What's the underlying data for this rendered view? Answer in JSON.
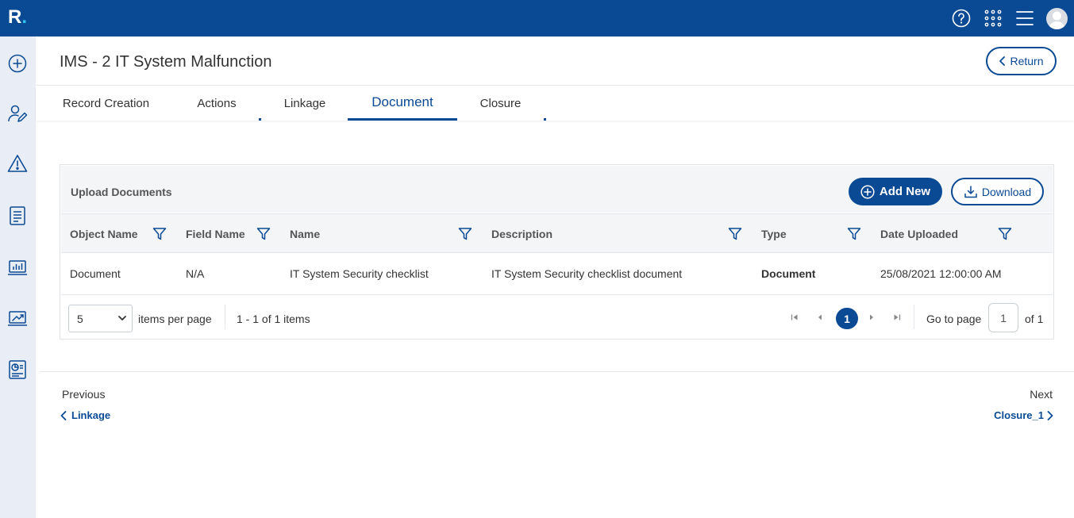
{
  "app": {
    "logo_letter": "R",
    "logo_dot": "."
  },
  "topbar": {
    "icons": [
      "help-icon",
      "apps-grid-icon",
      "menu-icon",
      "user-avatar"
    ]
  },
  "sidebar": {
    "icons": [
      "add-circle-icon",
      "user-edit-icon",
      "warning-icon",
      "document-list-icon",
      "laptop-chart-icon",
      "trend-chart-icon",
      "report-icon"
    ]
  },
  "header": {
    "title": "IMS - 2 IT System Malfunction",
    "return_label": "Return"
  },
  "tabs": [
    {
      "label": "Record Creation"
    },
    {
      "label": "Actions"
    },
    {
      "label": "Linkage"
    },
    {
      "label": "Document",
      "active": true
    },
    {
      "label": "Closure"
    }
  ],
  "panel": {
    "title": "Upload Documents",
    "add_label": "Add New",
    "download_label": "Download"
  },
  "table": {
    "columns": [
      "Object Name",
      "Field Name",
      "Name",
      "Description",
      "Type",
      "Date Uploaded"
    ],
    "rows": [
      {
        "object_name": "Document",
        "field_name": "N/A",
        "name": "IT System Security checklist",
        "description": "IT System Security checklist document",
        "type": "Document",
        "date_uploaded": "25/08/2021 12:00:00 AM"
      }
    ]
  },
  "pager": {
    "per_page": "5",
    "per_page_label": "items per page",
    "range_text": "1 - 1 of 1 items",
    "current_page": "1",
    "goto_label": "Go to page",
    "goto_value": "1",
    "of_label": "of 1"
  },
  "footer_nav": {
    "prev_label": "Previous",
    "prev_link": "Linkage",
    "next_label": "Next",
    "next_link": "Closure_1"
  },
  "colors": {
    "brand": "#0a4a94",
    "sidebar_bg": "#e9edf5",
    "header_bg": "#f4f5f7"
  }
}
